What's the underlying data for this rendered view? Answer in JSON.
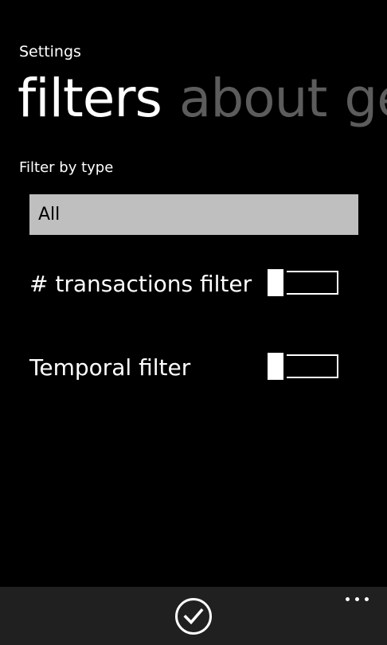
{
  "app": {
    "title": "Settings"
  },
  "pivot": {
    "headers": [
      {
        "label": "filters",
        "active": true
      },
      {
        "label": "about",
        "active": false
      },
      {
        "label": "ge",
        "active": false
      }
    ]
  },
  "filters": {
    "type_label": "Filter by type",
    "type_value": "All",
    "toggles": [
      {
        "label": "# transactions filter",
        "on": false
      },
      {
        "label": "Temporal filter",
        "on": false
      }
    ]
  },
  "app_bar": {
    "buttons": [
      {
        "icon": "check-icon"
      }
    ],
    "more_icon": "ellipsis-icon"
  },
  "colors": {
    "background": "#000000",
    "foreground": "#ffffff",
    "inactive_header": "#5c5c5c",
    "picker_background": "#bfbfbf",
    "app_bar": "#202020"
  }
}
